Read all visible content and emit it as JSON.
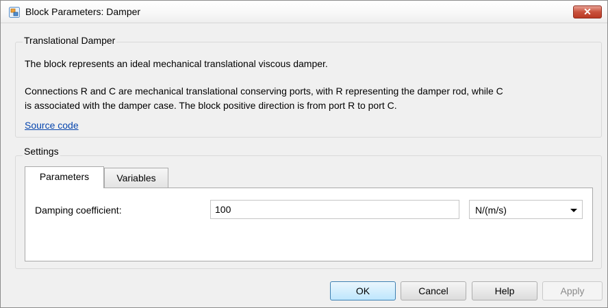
{
  "window": {
    "title": "Block Parameters: Damper",
    "close_symbol": "✕",
    "icons": {
      "app": "simulink-block-icon",
      "close": "close-icon"
    }
  },
  "description": {
    "group_title": "Translational Damper",
    "line1": "The block represents an ideal mechanical translational viscous damper.",
    "line2": "Connections R and C are mechanical translational conserving ports, with R representing the damper rod, while C",
    "line3": "is associated with the damper case. The block positive direction is from port R to port C.",
    "source_link": "Source code"
  },
  "settings": {
    "group_title": "Settings",
    "tabs": [
      {
        "label": "Parameters",
        "active": true
      },
      {
        "label": "Variables",
        "active": false
      }
    ],
    "damping": {
      "label": "Damping coefficient:",
      "value": "100",
      "unit": "N/(m/s)"
    }
  },
  "buttons": {
    "ok": "OK",
    "cancel": "Cancel",
    "help": "Help",
    "apply": "Apply"
  },
  "colors": {
    "link": "#0645ad",
    "close_button": "#c9513c",
    "default_button": "#bee6fd"
  }
}
